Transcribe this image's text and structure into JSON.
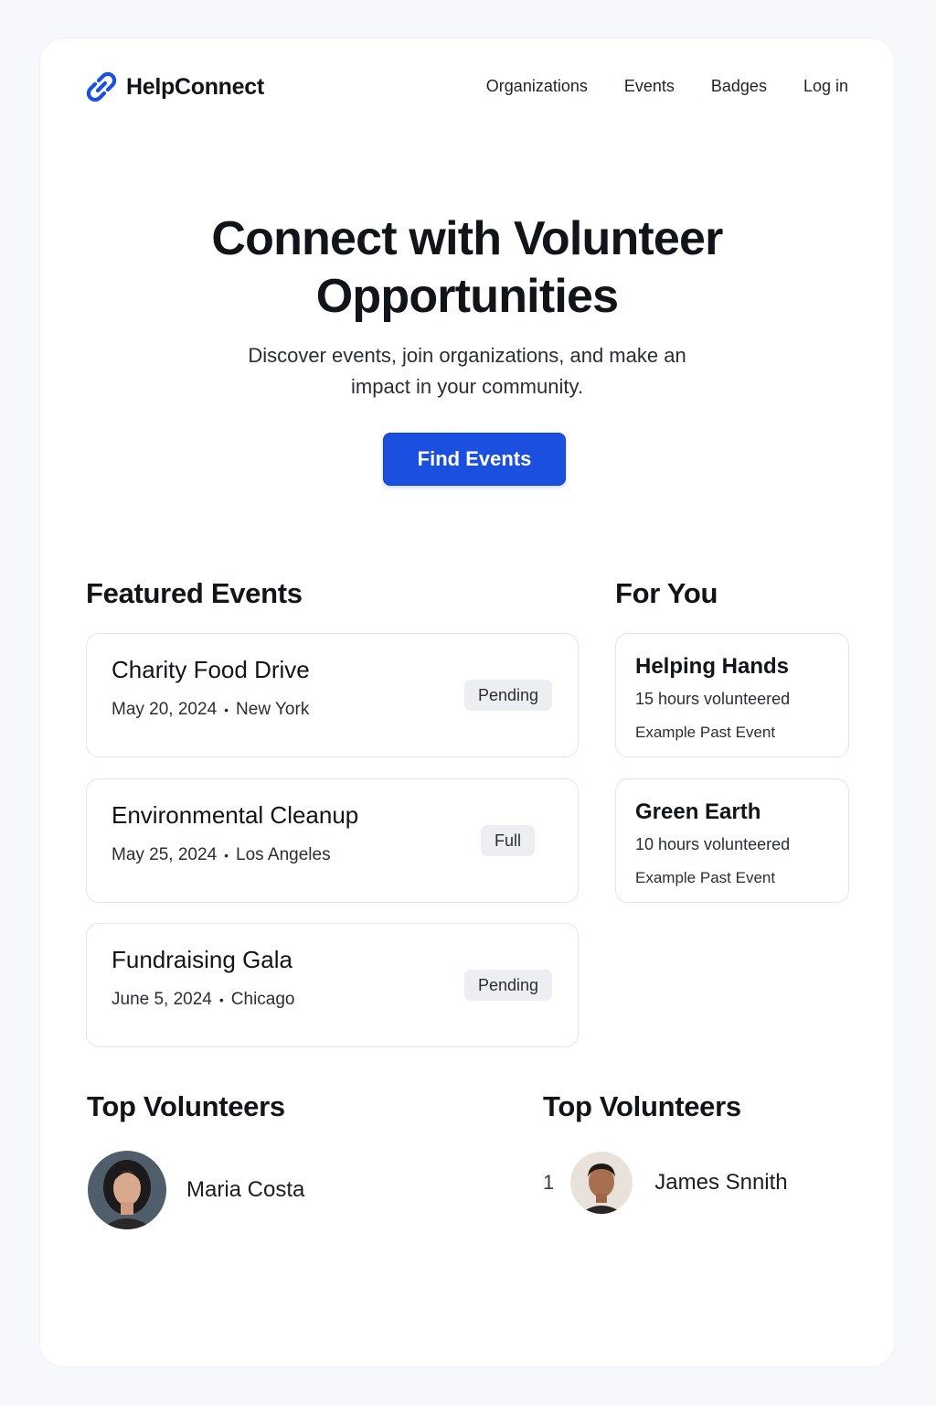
{
  "brand": {
    "name": "HelpConnect",
    "icon": "link-icon",
    "accent": "#1a4fe0"
  },
  "nav": {
    "items": [
      {
        "label": "Organizations"
      },
      {
        "label": "Events"
      },
      {
        "label": "Badges"
      },
      {
        "label": "Log in"
      }
    ]
  },
  "hero": {
    "title": "Connect with Volunteer Opportunities",
    "subtitle": "Discover events, join organizations, and make an impact in your community.",
    "cta_label": "Find Events"
  },
  "featured": {
    "heading": "Featured Events",
    "events": [
      {
        "title": "Charity Food Drive",
        "date": "May 20, 2024",
        "separator": "•",
        "location": "New York",
        "status": "Pending"
      },
      {
        "title": "Environmental Cleanup",
        "date": "May 25, 2024",
        "separator": "•",
        "location": "Los Angeles",
        "status": "Full"
      },
      {
        "title": "Fundraising Gala",
        "date": "June 5, 2024",
        "separator": "•",
        "location": "Chicago",
        "status": "Pending"
      }
    ]
  },
  "for_you": {
    "heading": "For You",
    "cards": [
      {
        "title": "Helping Hands",
        "hours": "15 hours volunteered",
        "event": "Example Past Event"
      },
      {
        "title": "Green Earth",
        "hours": "10 hours volunteered",
        "event": "Example Past Event"
      }
    ]
  },
  "top_volunteers_left": {
    "heading": "Top Volunteers",
    "volunteers": [
      {
        "name": "Maria Costa"
      }
    ]
  },
  "top_volunteers_right": {
    "heading": "Top Volunteers",
    "volunteers": [
      {
        "rank": "1",
        "name": "James Snnith"
      }
    ]
  }
}
